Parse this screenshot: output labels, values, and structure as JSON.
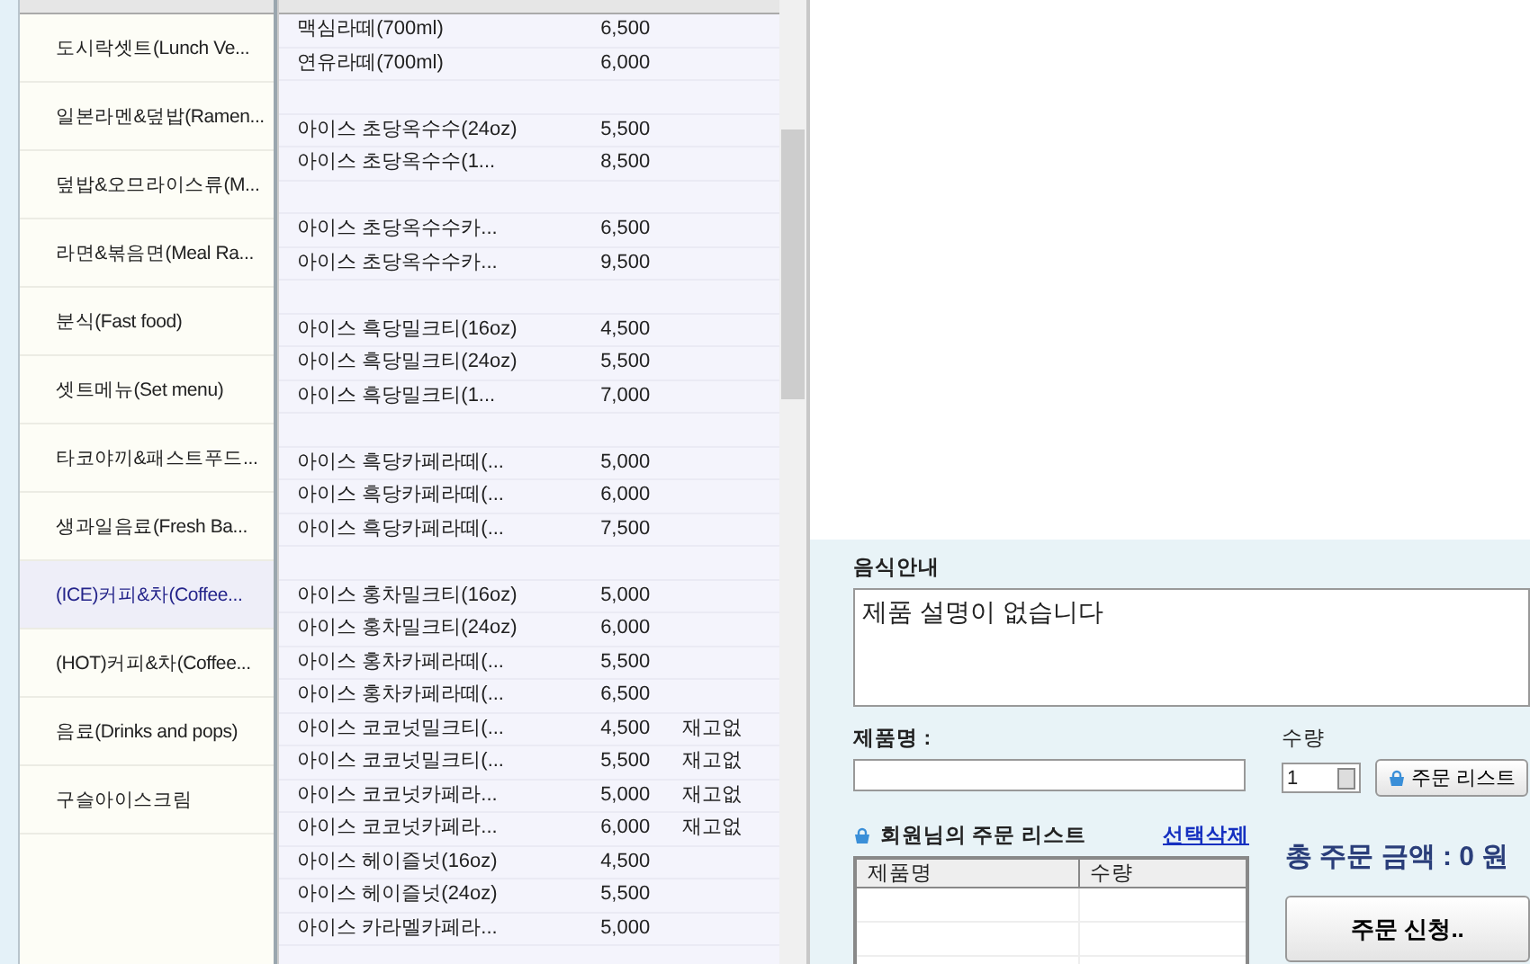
{
  "categories": [
    {
      "label": "도시락셋트(Lunch Ve...",
      "selected": false
    },
    {
      "label": "일본라멘&덮밥(Ramen...",
      "selected": false
    },
    {
      "label": "덮밥&오므라이스류(M...",
      "selected": false
    },
    {
      "label": "라면&볶음면(Meal Ra...",
      "selected": false
    },
    {
      "label": "분식(Fast food)",
      "selected": false
    },
    {
      "label": "셋트메뉴(Set menu)",
      "selected": false
    },
    {
      "label": "타코야끼&패스트푸드...",
      "selected": false
    },
    {
      "label": "생과일음료(Fresh Ba...",
      "selected": false
    },
    {
      "label": "(ICE)커피&차(Coffee...",
      "selected": true
    },
    {
      "label": "(HOT)커피&차(Coffee...",
      "selected": false
    },
    {
      "label": "음료(Drinks and pops)",
      "selected": false
    },
    {
      "label": "구슬아이스크림",
      "selected": false
    }
  ],
  "products": [
    {
      "kind": "item",
      "name": "맥심라떼(700ml)",
      "price": "6,500"
    },
    {
      "kind": "item",
      "name": "연유라떼(700ml)",
      "price": "6,000"
    },
    {
      "kind": "spacer"
    },
    {
      "kind": "item",
      "name": "아이스 초당옥수수(24oz)",
      "price": "5,500"
    },
    {
      "kind": "item",
      "name": "아이스 초당옥수수(1...",
      "price": "8,500"
    },
    {
      "kind": "spacer"
    },
    {
      "kind": "item",
      "name": "아이스 초당옥수수카...",
      "price": "6,500"
    },
    {
      "kind": "item",
      "name": "아이스 초당옥수수카...",
      "price": "9,500"
    },
    {
      "kind": "spacer"
    },
    {
      "kind": "item",
      "name": "아이스 흑당밀크티(16oz)",
      "price": "4,500"
    },
    {
      "kind": "item",
      "name": "아이스 흑당밀크티(24oz)",
      "price": "5,500"
    },
    {
      "kind": "item",
      "name": "아이스 흑당밀크티(1...",
      "price": "7,000"
    },
    {
      "kind": "spacer"
    },
    {
      "kind": "item",
      "name": "아이스 흑당카페라떼(...",
      "price": "5,000"
    },
    {
      "kind": "item",
      "name": "아이스 흑당카페라떼(...",
      "price": "6,000"
    },
    {
      "kind": "item",
      "name": "아이스 흑당카페라떼(...",
      "price": "7,500"
    },
    {
      "kind": "spacer"
    },
    {
      "kind": "item",
      "name": "아이스 홍차밀크티(16oz)",
      "price": "5,000"
    },
    {
      "kind": "item",
      "name": "아이스 홍차밀크티(24oz)",
      "price": "6,000"
    },
    {
      "kind": "item",
      "name": "아이스 홍차카페라떼(...",
      "price": "5,500"
    },
    {
      "kind": "item",
      "name": "아이스 홍차카페라떼(...",
      "price": "6,500"
    },
    {
      "kind": "item",
      "name": "아이스 코코넛밀크티(...",
      "price": "4,500",
      "stock": "재고없"
    },
    {
      "kind": "item",
      "name": "아이스 코코넛밀크티(...",
      "price": "5,500",
      "stock": "재고없"
    },
    {
      "kind": "item",
      "name": "아이스 코코넛카페라...",
      "price": "5,000",
      "stock": "재고없"
    },
    {
      "kind": "item",
      "name": "아이스 코코넛카페라...",
      "price": "6,000",
      "stock": "재고없"
    },
    {
      "kind": "item",
      "name": "아이스 헤이즐넛(16oz)",
      "price": "4,500"
    },
    {
      "kind": "item",
      "name": "아이스 헤이즐넛(24oz)",
      "price": "5,500"
    },
    {
      "kind": "item",
      "name": "아이스 카라멜카페라...",
      "price": "5,000"
    }
  ],
  "food_info": {
    "label": "음식안내",
    "text": "제품 설명이 없습니다"
  },
  "product_name": {
    "label": "제품명 :"
  },
  "quantity": {
    "label": "수량",
    "value": "1"
  },
  "add_button": "주문 리스트",
  "order_list": {
    "title": "회원님의 주문 리스트",
    "delete_link": "선택삭제",
    "columns": [
      "제품명",
      "수량"
    ]
  },
  "total": "총 주문 금액 : 0 원",
  "submit_button": "주문 신청.."
}
